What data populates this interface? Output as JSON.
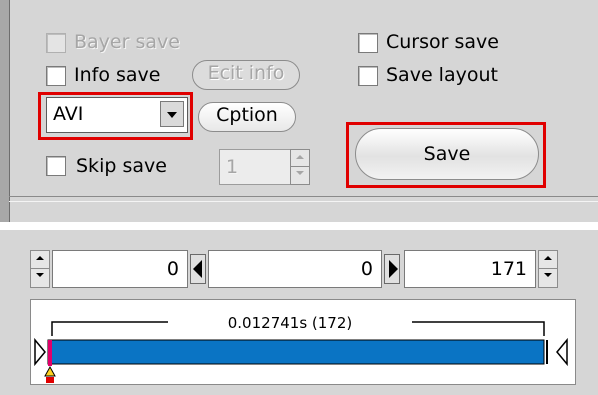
{
  "save_panel": {
    "bayer_save": {
      "label": "Bayer save",
      "checked": false,
      "enabled": false
    },
    "info_save": {
      "label": "Info save",
      "checked": false
    },
    "edit_info_label": "Ecit info",
    "format_select": {
      "value": "AVI"
    },
    "option_label": "Cption",
    "skip_save": {
      "label": "Skip save",
      "checked": false
    },
    "skip_value": "1",
    "cursor_save": {
      "label": "Cursor save",
      "checked": false
    },
    "save_layout": {
      "label": "Save layout",
      "checked": false
    },
    "save_label": "Save"
  },
  "playback": {
    "start_frame": "0",
    "current_frame": "0",
    "end_frame": "171",
    "range_label": "0.012741s (172)",
    "bar_color": "#0a74c4"
  },
  "colors": {
    "highlight": "#e00000",
    "panel_bg": "#d6d6d6"
  }
}
